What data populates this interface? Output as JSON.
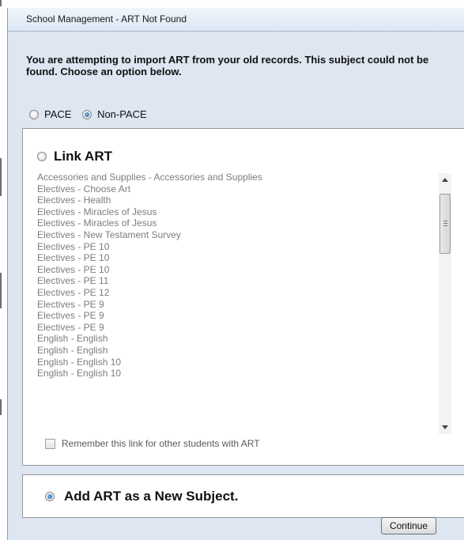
{
  "window": {
    "title": "School Management - ART Not Found"
  },
  "instructions": "You are attempting to import ART from your old records. This subject could not be found. Choose an option below.",
  "subject_type": {
    "options": [
      {
        "label": "PACE",
        "selected": false
      },
      {
        "label": "Non-PACE",
        "selected": true
      }
    ]
  },
  "link_section": {
    "label": "Link ART",
    "selected": false,
    "subjects": [
      "Accessories and Supplies - Accessories and Supplies",
      "Electives - Choose Art",
      "Electives - Health",
      "Electives - Miracles of Jesus",
      "Electives - Miracles of Jesus",
      "Electives - New Testament Survey",
      "Electives - PE 10",
      "Electives - PE 10",
      "Electives - PE 10",
      "Electives - PE 11",
      "Electives - PE 12",
      "Electives - PE 9",
      "Electives - PE 9",
      "Electives - PE 9",
      "English - English",
      "English - English",
      "English - English 10",
      "English - English 10"
    ],
    "remember_label": "Remember this link for other students with ART",
    "remember_checked": false
  },
  "add_section": {
    "label": "Add ART as a New Subject.",
    "selected": true
  },
  "continue_label": "Continue",
  "icons": [
    "radio-icon",
    "scroll-up-icon",
    "scroll-down-icon",
    "checkbox-icon"
  ]
}
